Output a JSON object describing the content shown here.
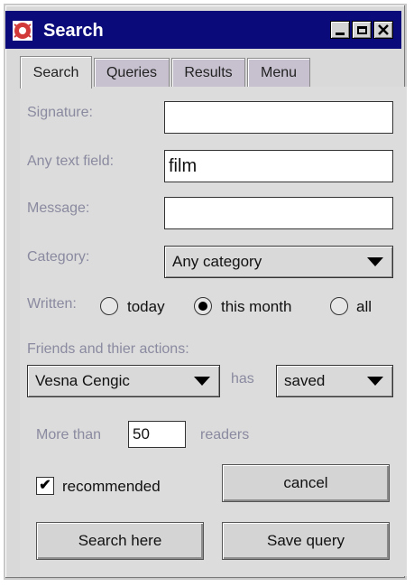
{
  "window": {
    "title": "Search"
  },
  "tabs": [
    {
      "label": "Search"
    },
    {
      "label": "Queries"
    },
    {
      "label": "Results"
    },
    {
      "label": "Menu"
    }
  ],
  "form": {
    "signature": {
      "label": "Signature:",
      "value": ""
    },
    "any_text": {
      "label": "Any text field:",
      "value": "film"
    },
    "message": {
      "label": "Message:",
      "value": ""
    },
    "category": {
      "label": "Category:",
      "value": "Any category"
    },
    "written": {
      "label": "Written:",
      "options": [
        {
          "label": "today",
          "selected": false
        },
        {
          "label": "this month",
          "selected": true
        },
        {
          "label": "all",
          "selected": false
        }
      ]
    },
    "friends": {
      "label": "Friends and thier actions:",
      "person": "Vesna Cengic",
      "connector": "has",
      "action": "saved"
    },
    "readers": {
      "prefix": "More than",
      "value": "50",
      "suffix": "readers"
    },
    "recommended": {
      "label": "recommended",
      "checked": true,
      "mark": "✔"
    }
  },
  "buttons": {
    "cancel": "cancel",
    "search_here": "Search here",
    "save_query": "Save query"
  }
}
